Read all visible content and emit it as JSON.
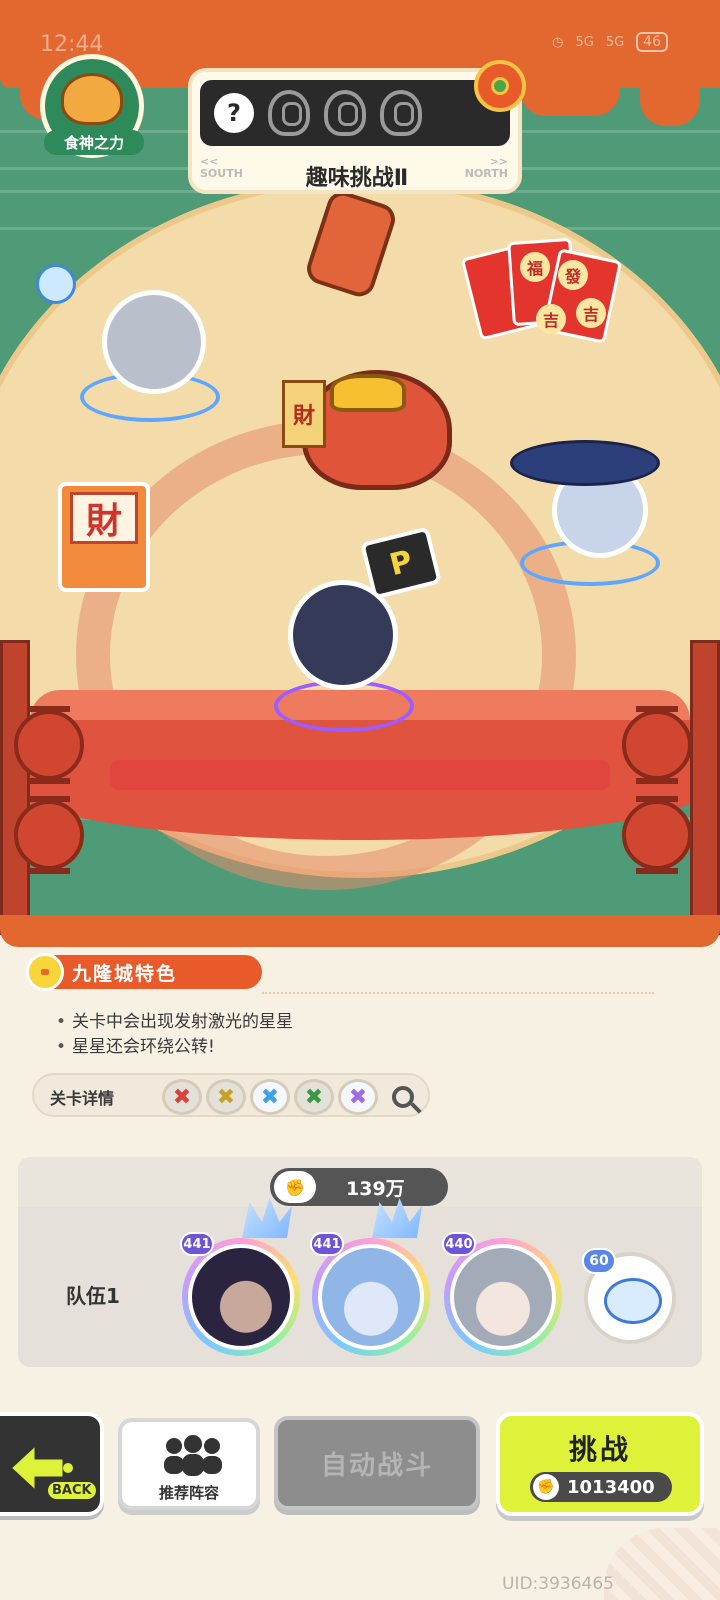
{
  "status_bar": {
    "time": "12:44",
    "signal_1": "5G",
    "signal_2": "5G",
    "battery": "46"
  },
  "logo": {
    "label": "食神之力",
    "icon": "melon-bun-icon"
  },
  "challenge": {
    "title": "趣味挑战Ⅱ",
    "help_icon": "?",
    "slipper_count": 3,
    "direction_left_arrows": "<<",
    "direction_left": "SOUTH",
    "direction_right_arrows": ">>",
    "direction_right": "NORTH"
  },
  "scene": {
    "banner_text": "財",
    "box_text": "財",
    "envelope_labels": [
      "福",
      "發",
      "吉",
      "吉"
    ]
  },
  "feature": {
    "title": "九隆城特色",
    "bullets": [
      "关卡中会出现发射激光的星星",
      "星星还会环绕公转!"
    ]
  },
  "stage_details": {
    "label": "关卡详情",
    "element_colors": [
      "#d9423a",
      "#c7a22a",
      "#3ea0e8",
      "#3a9a44",
      "#a26ae0"
    ]
  },
  "team": {
    "power": "139万",
    "label": "队伍1",
    "members": [
      {
        "level": "441",
        "colors": [
          "#2a2440",
          "#c7a89a"
        ]
      },
      {
        "level": "441",
        "colors": [
          "#8fb6e6",
          "#dfe8f8"
        ]
      },
      {
        "level": "440",
        "colors": [
          "#a3aab8",
          "#f2e6de"
        ]
      }
    ],
    "pet": {
      "level": "60"
    }
  },
  "buttons": {
    "back": "BACK",
    "recommend": "推荐阵容",
    "auto_battle": "自动战斗",
    "challenge": "挑战",
    "challenge_cost": "1013400"
  },
  "uid": "UID:3936465"
}
